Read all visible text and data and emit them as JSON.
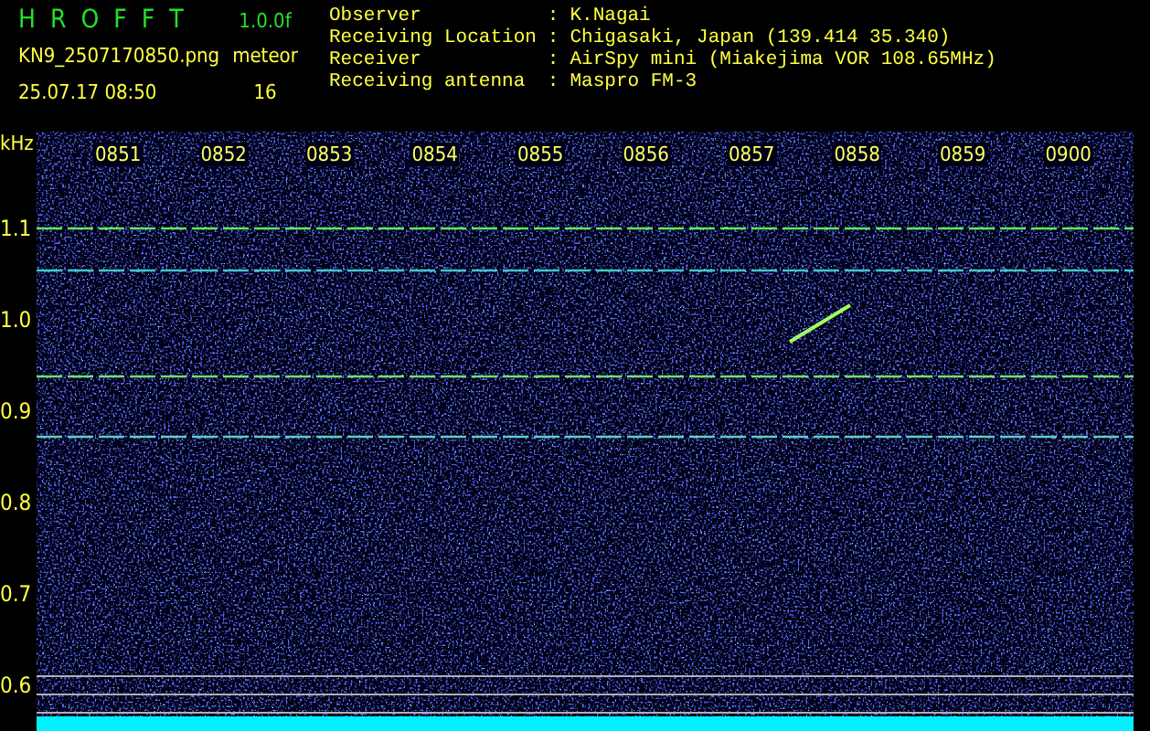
{
  "header": {
    "title": "H R O F F T",
    "version": "1.0.0f",
    "filename": "KN9_2507170850.png",
    "datetime": "25.07.17 08:50",
    "count_label": "meteor",
    "count": "16"
  },
  "info": [
    {
      "label": "Observer",
      "separator": ":",
      "value": "K.Nagai"
    },
    {
      "label": "Receiving Location",
      "separator": ":",
      "value": "Chigasaki, Japan (139.414 35.340)"
    },
    {
      "label": "Receiver",
      "separator": ":",
      "value": "AirSpy mini (Miakejima VOR 108.65MHz)"
    },
    {
      "label": "Receiving antenna",
      "separator": ":",
      "value": "Maspro FM-3"
    }
  ],
  "y_axis": {
    "unit": "kHz",
    "labels": [
      "1.1",
      "1.0",
      "0.9",
      "0.8",
      "0.7",
      "0.6"
    ]
  },
  "time_labels": [
    "0851",
    "0852",
    "0853",
    "0854",
    "0855",
    "0856",
    "0857",
    "0858",
    "0859",
    "0900"
  ]
}
